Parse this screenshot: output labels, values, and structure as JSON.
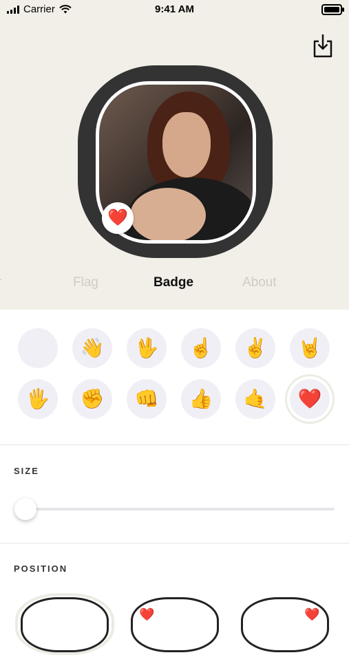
{
  "status_bar": {
    "carrier": "Carrier",
    "time": "9:41 AM"
  },
  "header": {
    "download_icon": "download-icon"
  },
  "preview": {
    "badge_emoji": "❤️"
  },
  "tabs": [
    {
      "label": "r",
      "active": false
    },
    {
      "label": "Flag",
      "active": false
    },
    {
      "label": "Badge",
      "active": true
    },
    {
      "label": "About",
      "active": false
    }
  ],
  "badges": {
    "items": [
      {
        "emoji": ""
      },
      {
        "emoji": "👋"
      },
      {
        "emoji": "🖖"
      },
      {
        "emoji": "☝️"
      },
      {
        "emoji": "✌️"
      },
      {
        "emoji": "🤘"
      },
      {
        "emoji": "🖐️"
      },
      {
        "emoji": "✊"
      },
      {
        "emoji": "👊"
      },
      {
        "emoji": "👍"
      },
      {
        "emoji": "🤙"
      },
      {
        "emoji": "❤️"
      }
    ],
    "selected_index": 11
  },
  "size_section": {
    "label": "SIZE",
    "value": 0
  },
  "position_section": {
    "label": "POSITION",
    "options": [
      {
        "heart": ""
      },
      {
        "heart": "❤️"
      },
      {
        "heart": "❤️"
      }
    ]
  },
  "colors": {
    "background_top": "#f1efe7",
    "frame": "#333333",
    "tab_inactive": "#cfccc3",
    "badge_circle": "#f0eff5"
  }
}
